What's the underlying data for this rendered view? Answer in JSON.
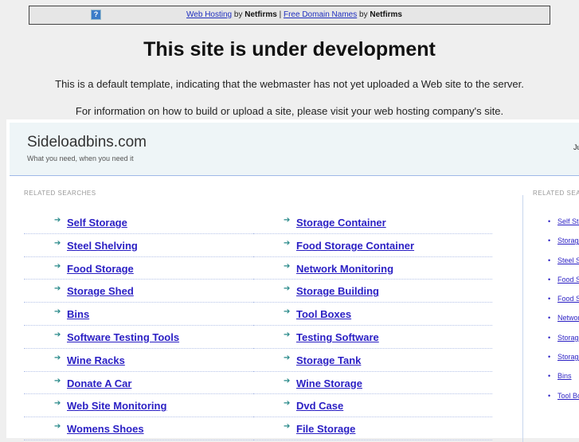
{
  "topbar": {
    "icon": "help-icon",
    "link1": "Web Hosting",
    "by1": "by",
    "brand1": "Netfirms",
    "sep": "|",
    "link2": "Free Domain Names",
    "by2": "by",
    "brand2": "Netfirms"
  },
  "heading": "This site is under development",
  "para1": "This is a default template, indicating that the webmaster has not yet uploaded a Web site to the server.",
  "para2": "For information on how to build or upload a site, please visit your web hosting company's site.",
  "site": {
    "name": "Sideloadbins.com",
    "tagline": "What you need, when you need it",
    "right_text": "Ju"
  },
  "related_label": "RELATED SEARCHES",
  "side_label": "RELATED SEA",
  "left_col": [
    "Self Storage",
    "Steel Shelving",
    "Food Storage",
    "Storage Shed",
    "Bins",
    "Software Testing Tools",
    "Wine Racks",
    "Donate A Car",
    "Web Site Monitoring",
    "Womens Shoes"
  ],
  "right_col": [
    "Storage Container",
    "Food Storage Container",
    "Network Monitoring",
    "Storage Building",
    "Tool Boxes",
    "Testing Software",
    "Storage Tank",
    "Wine Storage",
    "Dvd Case",
    "File Storage"
  ],
  "side_links": [
    "Self Storage",
    "Storage Container",
    "Steel Shelving",
    "Food Storage",
    "Food Storage Container",
    "Network Monitoring",
    "Storage Shed",
    "Storage Building",
    "Bins",
    "Tool Boxes"
  ]
}
